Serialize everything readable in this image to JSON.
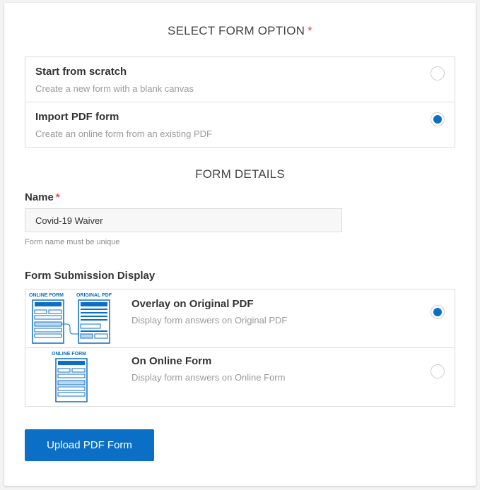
{
  "form_option": {
    "title": "SELECT FORM OPTION",
    "required_mark": "*",
    "options": [
      {
        "title": "Start from scratch",
        "description": "Create a new form with a blank canvas",
        "selected": false
      },
      {
        "title": "Import PDF form",
        "description": "Create an online form from an existing PDF",
        "selected": true
      }
    ]
  },
  "form_details": {
    "title": "FORM DETAILS",
    "name_label": "Name",
    "required_mark": "*",
    "name_value": "Covid-19 Waiver",
    "name_hint": "Form name must be unique"
  },
  "submission_display": {
    "label": "Form Submission Display",
    "options": [
      {
        "title": "Overlay on Original PDF",
        "description": "Display form answers on Original PDF",
        "selected": true,
        "illustration": {
          "left_label": "ONLINE FORM",
          "right_label": "ORIGINAL PDF"
        }
      },
      {
        "title": "On Online Form",
        "description": "Display form answers on Online Form",
        "selected": false,
        "illustration": {
          "label": "ONLINE FORM"
        }
      }
    ]
  },
  "upload_button": {
    "label": "Upload PDF Form"
  },
  "colors": {
    "accent": "#0b6fc6",
    "required": "#e5484d"
  }
}
